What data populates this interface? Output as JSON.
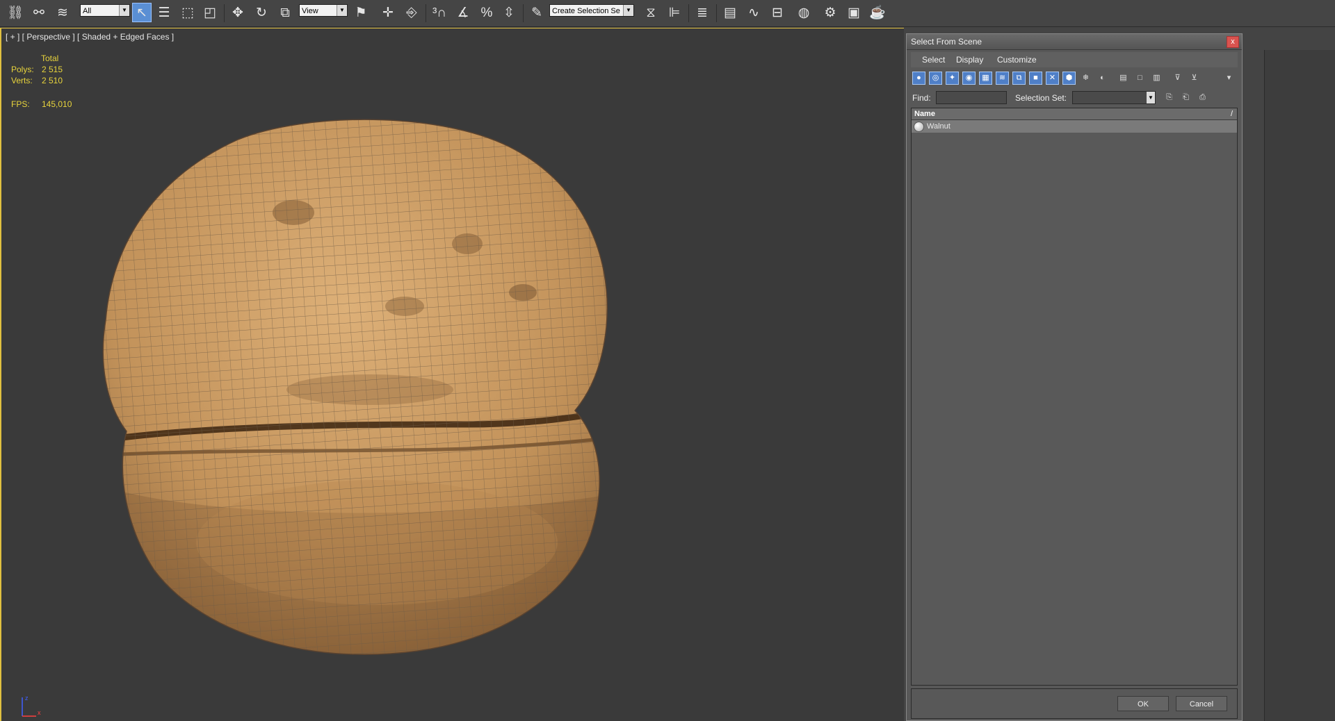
{
  "toolbar": {
    "selection_filter": "All",
    "reference_coord": "View",
    "named_selection": "Create Selection Se",
    "icons": [
      "link-icon",
      "unlink-icon",
      "bind-spacewarp-icon",
      "select-object-icon",
      "select-by-name-icon",
      "rect-region-icon",
      "window-crossing-icon",
      "move-icon",
      "rotate-icon",
      "scale-icon",
      "pivot-icon",
      "select-manipulate-icon",
      "snap-3d-icon",
      "angle-snap-icon",
      "percent-snap-icon",
      "spinner-snap-icon",
      "edit-named-selection-icon",
      "mirror-icon",
      "align-icon",
      "layer-explorer-icon",
      "ribbon-icon",
      "curve-editor-icon",
      "schematic-view-icon",
      "material-editor-icon",
      "render-setup-icon",
      "rendered-frame-icon",
      "render-icon"
    ]
  },
  "viewport": {
    "label": "[ + ] [ Perspective ] [ Shaded + Edged Faces ]",
    "stats": {
      "total_label": "Total",
      "polys_label": "Polys:",
      "polys_value": "2 515",
      "verts_label": "Verts:",
      "verts_value": "2 510",
      "fps_label": "FPS:",
      "fps_value": "145,010"
    },
    "gizmo": {
      "x_label": "x",
      "z_label": "z"
    }
  },
  "dialog": {
    "title": "Select From Scene",
    "close_glyph": "x",
    "menu": [
      "Select",
      "Display",
      "Customize"
    ],
    "find_label": "Find:",
    "find_value": "",
    "selection_set_label": "Selection Set:",
    "selection_set_value": "",
    "column_name": "Name",
    "sort_glyph": "/",
    "objects": [
      {
        "name": "Walnut"
      }
    ],
    "ok_label": "OK",
    "cancel_label": "Cancel"
  },
  "colors": {
    "viewport_border": "#e0c040",
    "stats_text": "#e8d43c",
    "walnut_base": "#c99a62",
    "wireframe": "#6e5a45"
  }
}
